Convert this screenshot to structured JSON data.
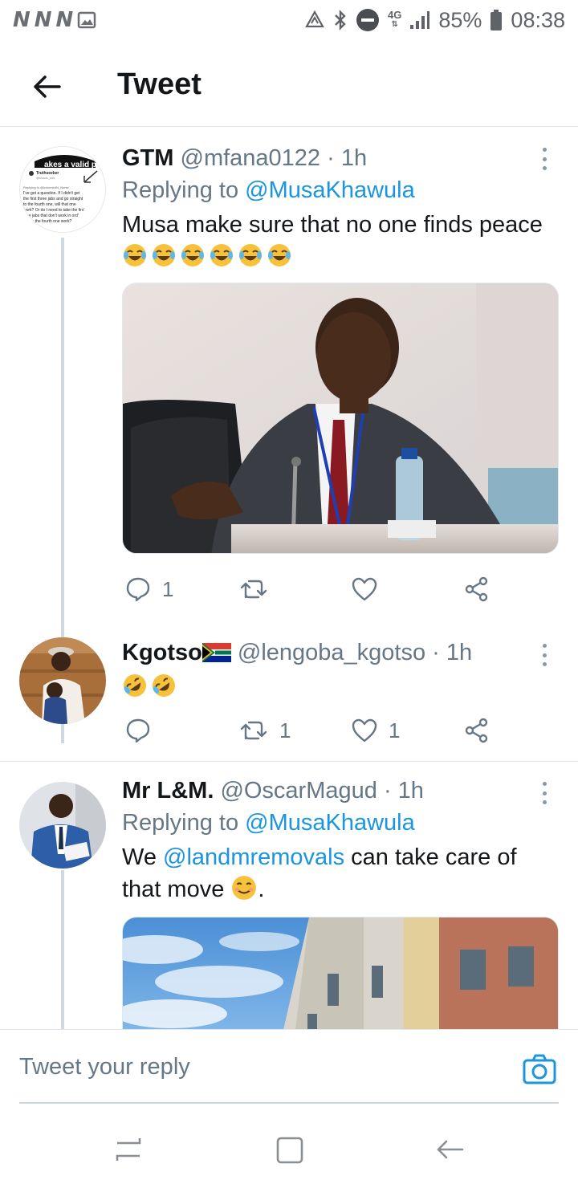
{
  "status_bar": {
    "battery": "85%",
    "time": "08:38",
    "network": "4G"
  },
  "header": {
    "title": "Tweet"
  },
  "tweets": [
    {
      "name": "GTM",
      "handle": "@mfana0122",
      "time": "· 1h",
      "replying_prefix": "Replying to ",
      "replying_to": "@MusaKhawula",
      "text": "Musa make sure that no one finds peace",
      "emoji_count": 6,
      "emoji": "face-with-tears-of-joy",
      "avatar_lines": [
        "akes a valid p",
        "Truthseeker",
        "@chadc_mfe",
        "Replying to @InformedN_Nurse",
        "I've got a question. If I didn't get",
        "the first three jabs and go straight",
        "to the fourth one, will that one",
        "work? Or do I need to take the firs'",
        "he jabs that don't work in ord'",
        "ke the fourth one work?"
      ],
      "media": "photo-man-in-suit-at-microphone",
      "replies": "1",
      "retweets": "",
      "likes": ""
    },
    {
      "name": "Kgotso",
      "flag": "south-africa-flag",
      "handle": "@lengoba_kgotso",
      "time": "· 1h",
      "emoji_count": 2,
      "emoji": "rolling-on-the-floor-laughing",
      "replies": "",
      "retweets": "1",
      "likes": "1"
    },
    {
      "name": "Mr L&M.",
      "handle": "@OscarMagud",
      "time": "· 1h",
      "replying_prefix": "Replying to ",
      "replying_to": "@MusaKhawula",
      "text_prefix": "We ",
      "mention": "@landmremovals",
      "text_suffix": " can take care of",
      "text_line2": "that move ",
      "text_end": ".",
      "media": "photo-building-blue-sky"
    }
  ],
  "reply_bar": {
    "placeholder": "Tweet your reply"
  },
  "colors": {
    "accent": "#1b95e0",
    "muted": "#657786",
    "text": "#14171a",
    "divider": "#e1e8ed"
  },
  "icons": [
    "back-arrow-icon",
    "more-icon",
    "reply-icon",
    "retweet-icon",
    "like-icon",
    "share-icon",
    "camera-icon",
    "recents-icon",
    "home-icon",
    "nav-back-icon"
  ]
}
